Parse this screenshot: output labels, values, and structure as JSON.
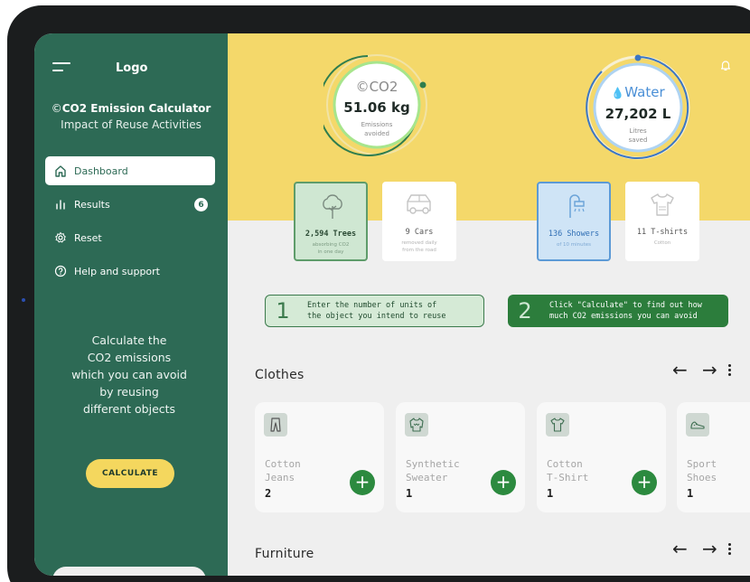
{
  "sidebar": {
    "logo": "Logo",
    "title": "CO2 Emission Calculator",
    "subtitle": "Impact of Reuse Activities",
    "nav": [
      {
        "label": "Dashboard",
        "icon": "home-icon",
        "active": true
      },
      {
        "label": "Results",
        "icon": "bar-chart-icon",
        "badge": "6"
      },
      {
        "label": "Reset",
        "icon": "settings-icon"
      },
      {
        "label": "Help and support",
        "icon": "help-icon"
      }
    ],
    "description": [
      "Calculate the",
      "CO2 emissions",
      "which you can avoid",
      "by reusing",
      "different objects"
    ],
    "calculate_label": "CALCULATE"
  },
  "co2": {
    "title": "CO2",
    "value": "51.06 kg",
    "caption_line1": "Emissions",
    "caption_line2": "avoided",
    "ring_color": "#9be07a"
  },
  "water": {
    "title": "Water",
    "value": "27,202 L",
    "caption_line1": "Litres",
    "caption_line2": "saved",
    "ring_color": "#4a8fd6"
  },
  "stats": [
    {
      "value": "2,594 Trees",
      "note1": "absorbing CO2",
      "note2": "in one day",
      "icon": "tree-icon",
      "highlight": "green"
    },
    {
      "value": "9 Cars",
      "note1": "removed daily",
      "note2": "from the road",
      "icon": "car-icon",
      "highlight": "none"
    },
    {
      "value": "136 Showers",
      "note1": "of 10 minutes",
      "note2": "",
      "icon": "shower-icon",
      "highlight": "blue"
    },
    {
      "value": "11 T-shirts",
      "note1": "Cotton",
      "note2": "",
      "icon": "tshirt-icon",
      "highlight": "none"
    }
  ],
  "steps": [
    {
      "number": "1",
      "line1": "Enter the number of units of",
      "line2": "the object you intend to reuse"
    },
    {
      "number": "2",
      "line1": "Click \"Calculate\" to find out how",
      "line2": "much CO2 emissions you can avoid"
    }
  ],
  "sections": {
    "clothes": "Clothes",
    "furniture": "Furniture"
  },
  "items": [
    {
      "name1": "Cotton",
      "name2": "Jeans",
      "qty": "2",
      "icon": "jeans-icon"
    },
    {
      "name1": "Synthetic",
      "name2": "Sweater",
      "qty": "1",
      "icon": "sweater-icon"
    },
    {
      "name1": "Cotton",
      "name2": "T-Shirt",
      "qty": "1",
      "icon": "tshirt-icon"
    },
    {
      "name1": "Sport",
      "name2": "Shoes",
      "qty": "1",
      "icon": "shoes-icon"
    }
  ],
  "colors": {
    "sidebar": "#2d6a55",
    "header": "#f4d86a",
    "accent": "#2c8a3f",
    "calculate": "#f4d75e"
  }
}
